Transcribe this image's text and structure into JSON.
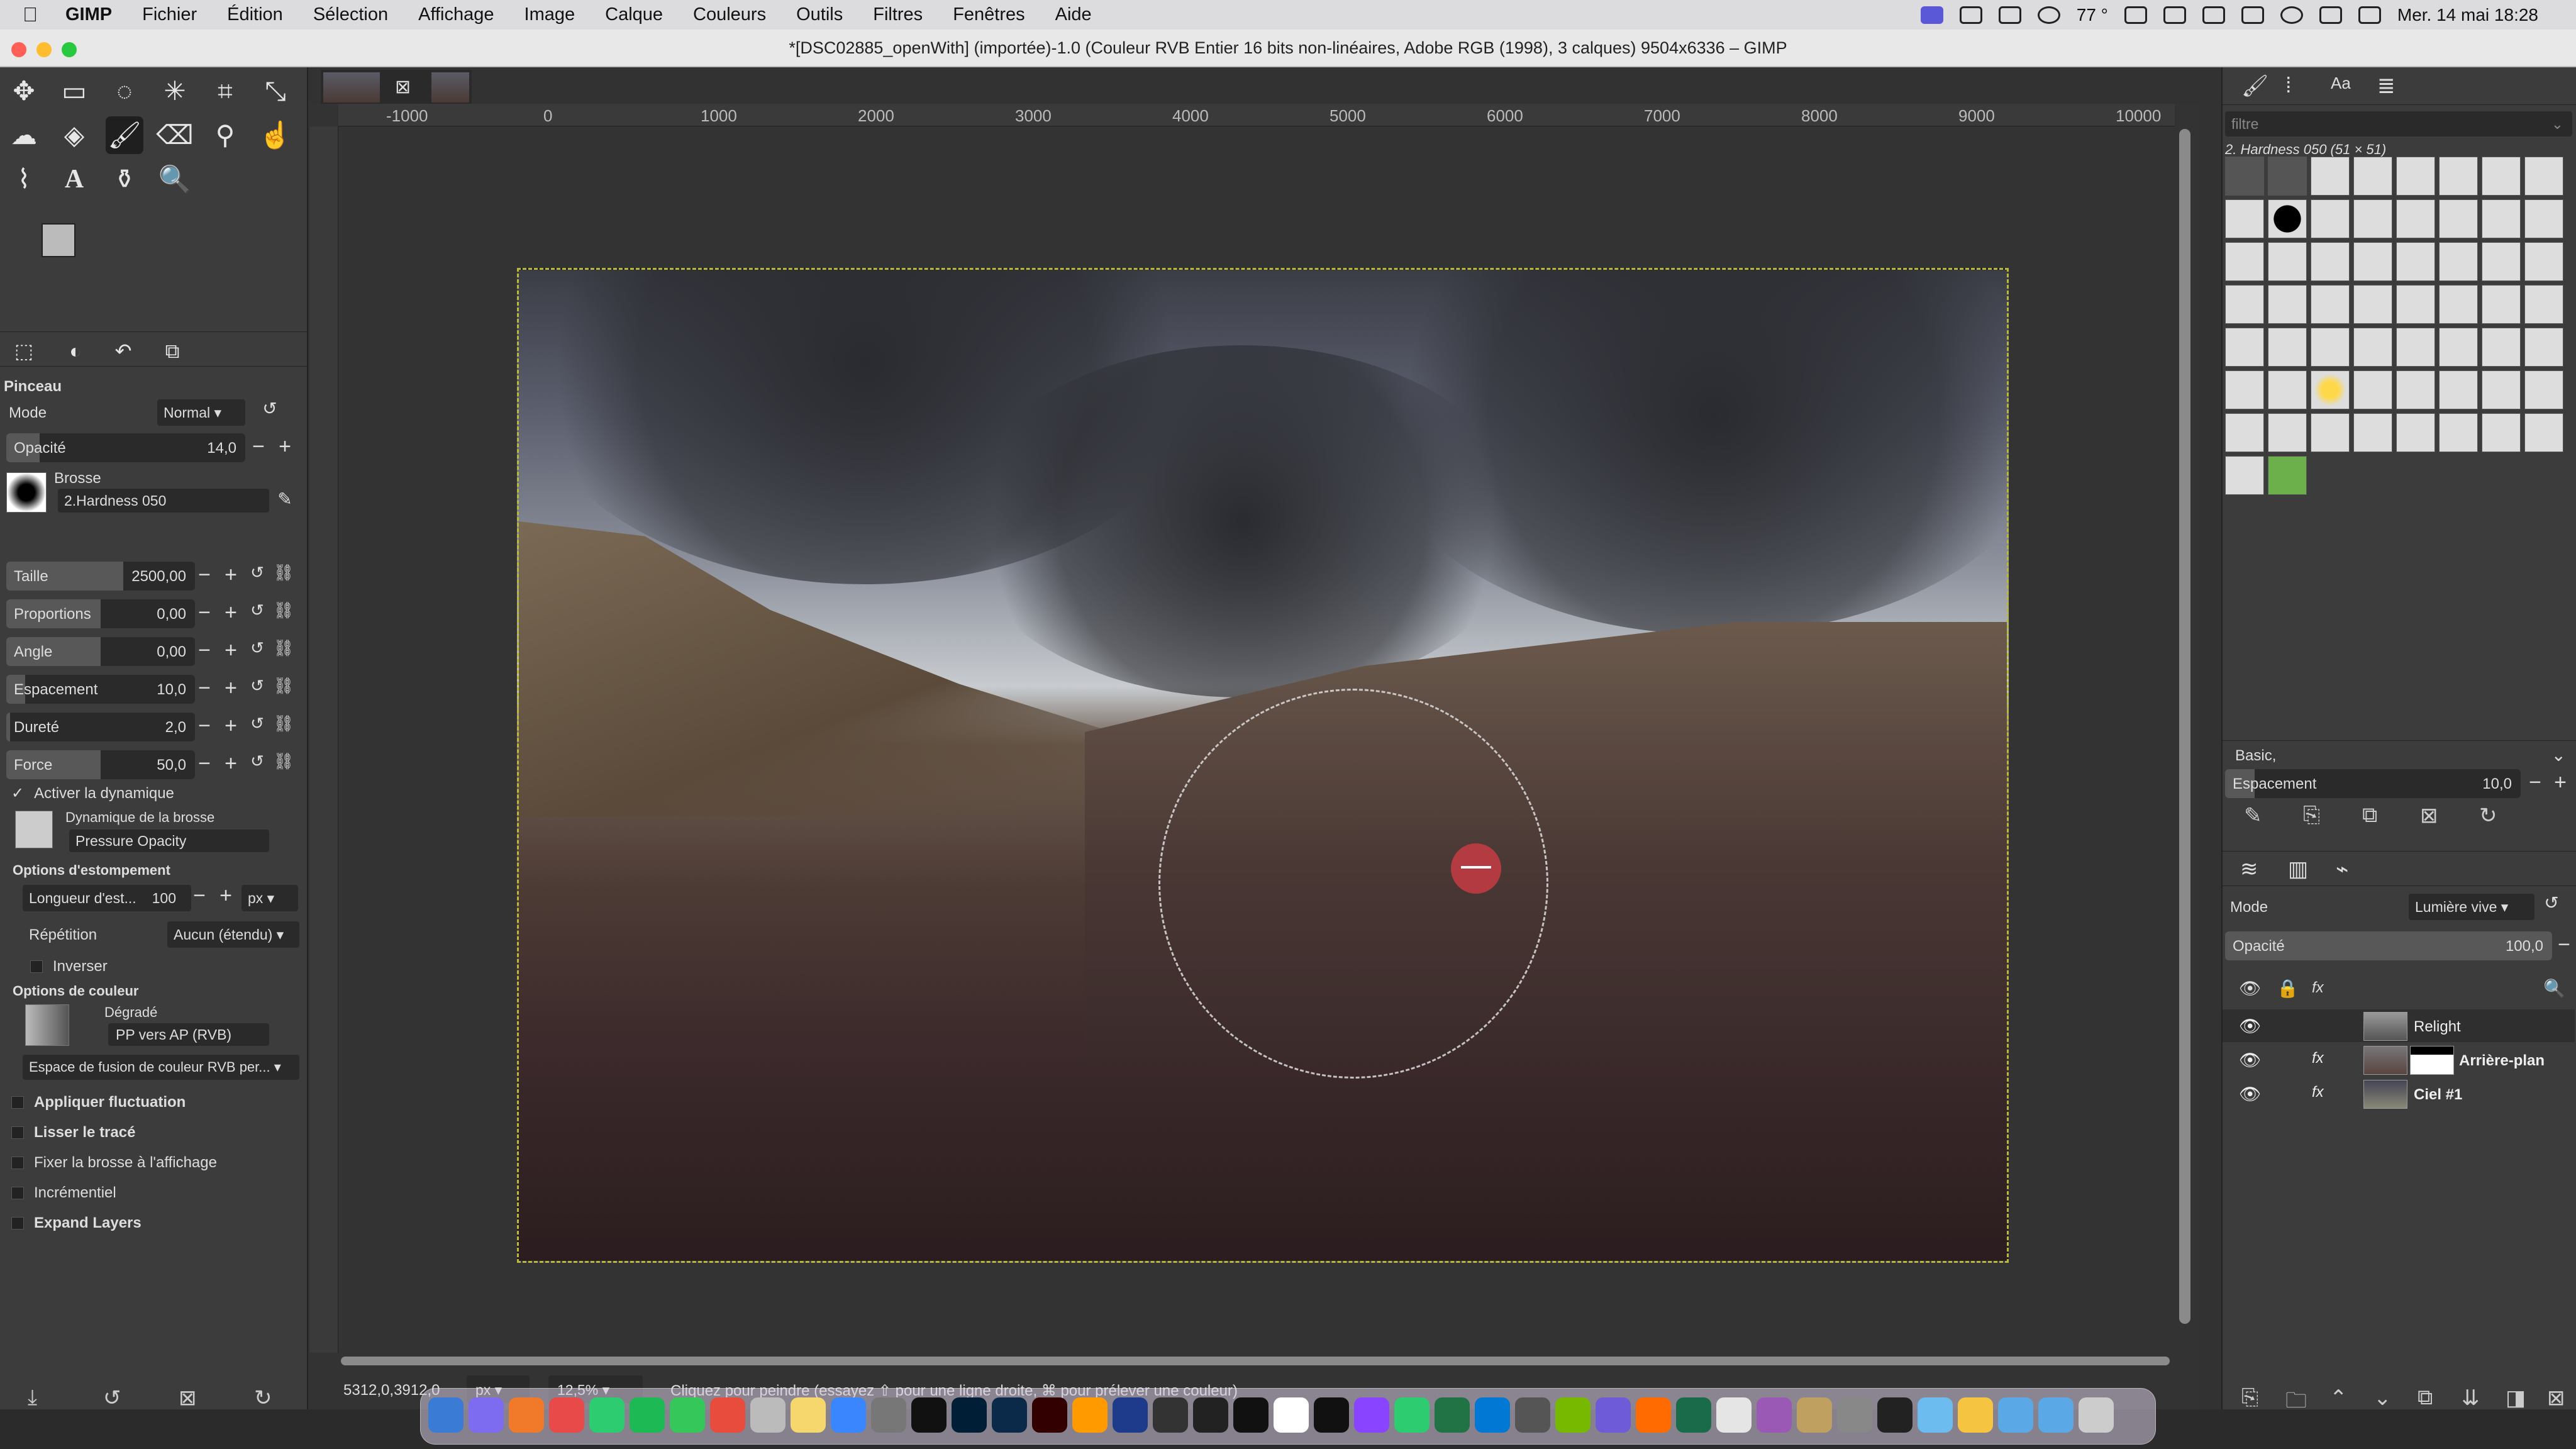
{
  "menubar": {
    "app": "GIMP",
    "items": [
      "Fichier",
      "Édition",
      "Sélection",
      "Affichage",
      "Image",
      "Calque",
      "Couleurs",
      "Outils",
      "Filtres",
      "Fenêtres",
      "Aide"
    ],
    "temperature": "77 °",
    "datetime": "Mer. 14 mai  18:28"
  },
  "window": {
    "title": "*[DSC02885_openWith] (importée)-1.0 (Couleur RVB Entier 16 bits non-linéaires, Adobe RGB (1998), 3 calques) 9504x6336 – GIMP"
  },
  "tool_options": {
    "title": "Pinceau",
    "mode_label": "Mode",
    "mode_value": "Normal",
    "opacity": {
      "label": "Opacité",
      "value": "14,0",
      "fraction": 0.14
    },
    "brush_label": "Brosse",
    "brush_name": "2.Hardness 050",
    "sliders": [
      {
        "label": "Taille",
        "value": "2500,00",
        "fraction": 0.62
      },
      {
        "label": "Proportions",
        "value": "0,00",
        "fraction": 0.5
      },
      {
        "label": "Angle",
        "value": "0,00",
        "fraction": 0.5
      },
      {
        "label": "Espacement",
        "value": "10,0",
        "fraction": 0.1
      },
      {
        "label": "Dureté",
        "value": "2,0",
        "fraction": 0.02
      },
      {
        "label": "Force",
        "value": "50,0",
        "fraction": 0.5
      }
    ],
    "dynamics_enable": "Activer la dynamique",
    "dynamics_label": "Dynamique de la brosse",
    "dynamics_value": "Pressure Opacity",
    "fade_options": "Options d'estompement",
    "fade_length_label": "Longueur d'est...",
    "fade_length_value": "100",
    "fade_unit": "px",
    "repeat_label": "Répétition",
    "repeat_value": "Aucun (étendu)",
    "invert": "Inverser",
    "color_options": "Options de couleur",
    "gradient_label": "Dégradé",
    "gradient_value": "PP vers AP (RVB)",
    "blend_space": "Espace de fusion de couleur  RVB per...",
    "checks": [
      "Appliquer fluctuation",
      "Lisser le tracé",
      "Fixer la brosse à l'affichage",
      "Incrémentiel",
      "Expand Layers"
    ]
  },
  "ruler": {
    "ticks": [
      "-1000",
      "0",
      "1000",
      "2000",
      "3000",
      "4000",
      "5000",
      "6000",
      "7000",
      "8000",
      "9000",
      "10000"
    ]
  },
  "statusbar": {
    "coords": "5312,0,3912,0",
    "unit": "px",
    "zoom": "12,5%",
    "message": "Cliquez pour peindre (essayez ⇧ pour une ligne droite, ⌘ pour prélever une couleur)"
  },
  "brushes_panel": {
    "filter_placeholder": "filtre",
    "selected": "2. Hardness 050 (51 × 51)",
    "tag": "Basic,",
    "spacing_label": "Espacement",
    "spacing_value": "10,0"
  },
  "layers_panel": {
    "mode_label": "Mode",
    "mode_value": "Lumière vive",
    "opacity_label": "Opacité",
    "opacity_value": "100,0",
    "layers": [
      {
        "name": "Relight"
      },
      {
        "name": "Arrière-plan"
      },
      {
        "name": "Ciel #1"
      }
    ]
  },
  "colors": {
    "accent": "#5a58d6",
    "selection": "#b7b93a"
  }
}
